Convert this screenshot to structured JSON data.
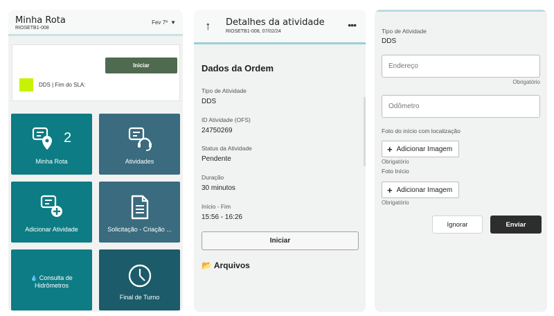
{
  "minha_rota": {
    "title": "Minha Rota",
    "subtitle": "RIOSETB1-008",
    "date": "Fev 7º",
    "sla_card": {
      "iniciar_label": "Iniciar",
      "text": "DDS | Fim do SLA:",
      "swatch_color": "#c7f200"
    },
    "tiles": [
      {
        "label": "Minha Rota",
        "count": "2",
        "icon": "route-pin-icon",
        "color": "#0d7c84"
      },
      {
        "label": "Atividades",
        "icon": "activities-headset-icon",
        "color": "#3a6b7e"
      },
      {
        "label": "Adicionar Atividade",
        "icon": "add-activity-icon",
        "color": "#0d7c84"
      },
      {
        "label": "Solicitação - Criação ...",
        "icon": "document-icon",
        "color": "#3a6b7e"
      },
      {
        "label": "Consulta de Hidrômetros",
        "icon": "water-meter-icon",
        "color": "#0d7c84"
      },
      {
        "label": "Final de Turno",
        "icon": "clock-icon",
        "color": "#1b5b6a"
      }
    ]
  },
  "detalhes": {
    "title": "Detalhes da atividade",
    "subtitle": "RIOSETB1-008, 07/02/24",
    "section_title": "Dados da Ordem",
    "fields": [
      {
        "label": "Tipo de Atividade",
        "value": "DDS"
      },
      {
        "label": "ID Atividade (OFS)",
        "value": "24750269"
      },
      {
        "label": "Status da Atividade",
        "value": "Pendente"
      },
      {
        "label": "Duração",
        "value": "30 minutos"
      },
      {
        "label": "Início - Fim",
        "value": "15:56 - 16:26"
      }
    ],
    "iniciar_label": "Iniciar",
    "arquivos_label": "Arquivos"
  },
  "form": {
    "tipo_label": "Tipo de Atividade",
    "tipo_value": "DDS",
    "endereco_placeholder": "Endereço",
    "endereco_required": "Obrigatório",
    "odometro_placeholder": "Odômetro",
    "foto_inicio_loc_label": "Foto do início com localização",
    "add_image_label": "Adicionar Imagem",
    "foto_inicio_loc_required": "Obrigatório",
    "foto_inicio_label": "Foto Início",
    "add_image_label_2": "Adicionar Imagem",
    "foto_inicio_required": "Obrigatório",
    "ignorar_label": "Ignorar",
    "enviar_label": "Enviar"
  },
  "colors": {
    "accent_teal": "#0d7c84",
    "slate_tile": "#3a6b7e",
    "dark_tile": "#1b5b6a",
    "iniciar_green": "#4f6a4f",
    "enviar_dark": "#2d2d2d"
  }
}
